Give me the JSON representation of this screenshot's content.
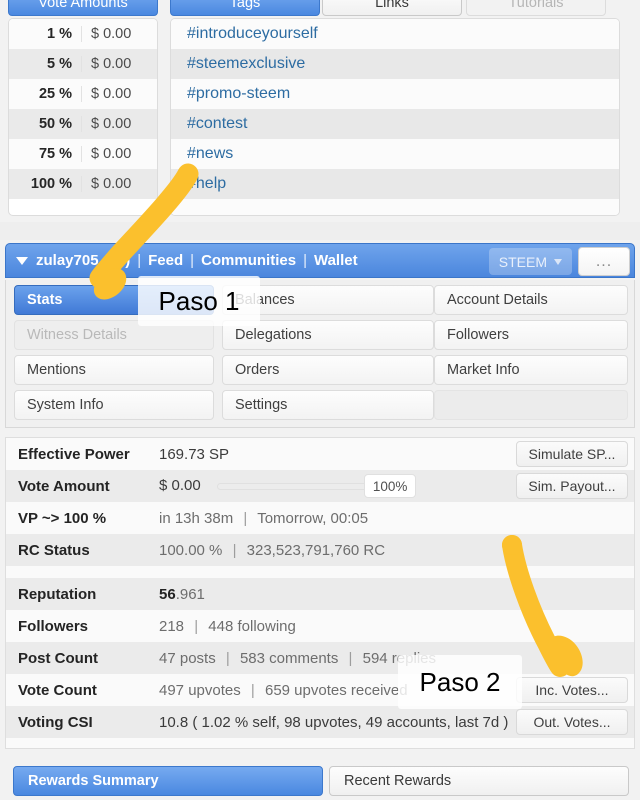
{
  "top_panel": {
    "tabs": [
      {
        "label": "Vote Amounts",
        "state": "active"
      },
      {
        "label": "Tags",
        "state": "active"
      },
      {
        "label": "Links",
        "state": "normal"
      },
      {
        "label": "Tutorials",
        "state": "disabled"
      }
    ],
    "vote_amounts": {
      "rows": [
        {
          "percent": "1 %",
          "value": "$ 0.00"
        },
        {
          "percent": "5 %",
          "value": "$ 0.00"
        },
        {
          "percent": "25 %",
          "value": "$ 0.00"
        },
        {
          "percent": "50 %",
          "value": "$ 0.00"
        },
        {
          "percent": "75 %",
          "value": "$ 0.00"
        },
        {
          "percent": "100 %",
          "value": "$ 0.00"
        }
      ]
    },
    "tags": [
      "#introduceyourself",
      "#steemexclusive",
      "#promo-steem",
      "#contest",
      "#news",
      "#help"
    ]
  },
  "user_bar": {
    "username": "zulay705",
    "reputation_badge": "(56)",
    "links": [
      "Feed",
      "Communities",
      "Wallet"
    ],
    "separator": "|",
    "token_selector": "STEEM",
    "more_button": "..."
  },
  "nav_grid": [
    {
      "label": "Stats",
      "state": "active"
    },
    {
      "label": "Balances",
      "state": "normal"
    },
    {
      "label": "Account Details",
      "state": "normal"
    },
    {
      "label": "Witness Details",
      "state": "dim"
    },
    {
      "label": "Delegations",
      "state": "normal"
    },
    {
      "label": "Followers",
      "state": "normal"
    },
    {
      "label": "Mentions",
      "state": "normal"
    },
    {
      "label": "Orders",
      "state": "normal"
    },
    {
      "label": "Market Info",
      "state": "normal"
    },
    {
      "label": "System Info",
      "state": "normal"
    },
    {
      "label": "Settings",
      "state": "normal"
    },
    {
      "label": "",
      "state": "blank"
    }
  ],
  "stats": {
    "effective_power": {
      "label": "Effective Power",
      "value": "169.73 SP"
    },
    "vote_amount": {
      "label": "Vote Amount",
      "value": "$ 0.00",
      "slider_percent": "100%"
    },
    "vp_to_100": {
      "label": "VP ~> 100 %",
      "value_a": "in 13h 38m",
      "sep": "|",
      "value_b": "Tomorrow, 00:05"
    },
    "rc_status": {
      "label": "RC Status",
      "value_a": "100.00 %",
      "sep": "|",
      "value_b": "323,523,791,760 RC"
    },
    "reputation": {
      "label": "Reputation",
      "value_int": "56",
      "value_frac": ".961"
    },
    "followers": {
      "label": "Followers",
      "value_a": "218",
      "sep": "|",
      "value_b": "448 following"
    },
    "post_count": {
      "label": "Post Count",
      "value_a": "47 posts",
      "sep": "|",
      "value_b": "583 comments",
      "sep2": "|",
      "value_c": "594 replies"
    },
    "vote_count": {
      "label": "Vote Count",
      "value_a": "497 upvotes",
      "sep": "|",
      "value_b": "659 upvotes received"
    },
    "voting_csi": {
      "label": "Voting CSI",
      "value": "10.8 ( 1.02 % self, 98 upvotes, 49 accounts, last 7d )"
    },
    "buttons": {
      "simulate_sp": "Simulate SP...",
      "sim_payout": "Sim. Payout...",
      "inc_votes": "Inc. Votes...",
      "out_votes": "Out. Votes..."
    }
  },
  "bottom_tabs": [
    {
      "label": "Rewards Summary",
      "state": "active"
    },
    {
      "label": "Recent Rewards",
      "state": "normal"
    }
  ],
  "annotations": {
    "step1": "Paso 1",
    "step2": "Paso 2",
    "arrow_color": "#fbc02d"
  }
}
